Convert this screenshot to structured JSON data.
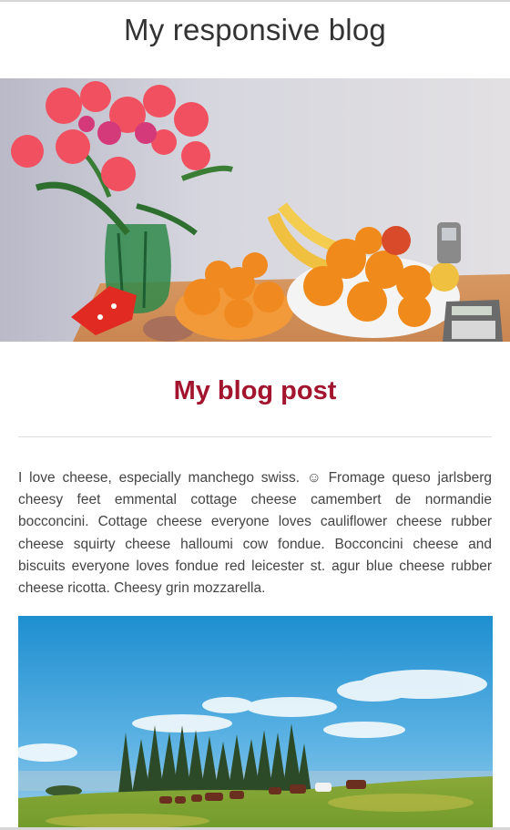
{
  "site": {
    "title": "My responsive blog"
  },
  "hero_image": {
    "alt": "flowers-and-fruit-photo"
  },
  "post": {
    "title": "My blog post",
    "body": "I love cheese, especially manchego swiss. ☺ Fromage queso jarlsberg cheesy feet emmental cottage cheese camembert de normandie bocconcini. Cottage cheese everyone loves cauliflower cheese rubber cheese squirty cheese halloumi cow fondue. Bocconcini cheese and biscuits everyone loves fondue red leicester st. agur blue cheese rubber cheese ricotta. Cheesy grin mozzarella."
  },
  "landscape_image": {
    "alt": "horses-on-hillside-photo"
  },
  "colors": {
    "post_title": "#a3152f",
    "text": "#444444",
    "divider": "#dddddd"
  }
}
